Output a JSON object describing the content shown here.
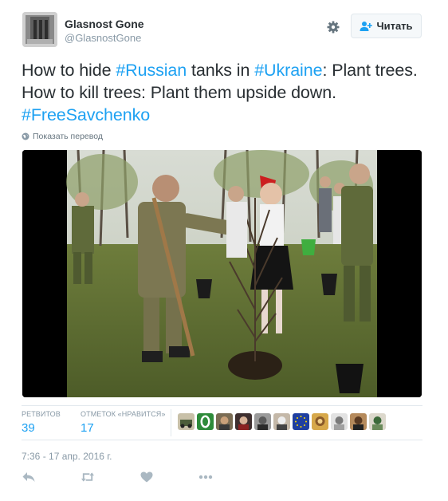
{
  "tweet": {
    "author": {
      "name": "Glasnost Gone",
      "handle": "@GlasnostGone"
    },
    "follow_button": {
      "label": "Читать",
      "icon": "add-user-icon"
    },
    "settings_icon": "gear-icon",
    "text": {
      "part1": "How to hide ",
      "hashtag1": "#Russian",
      "part2": " tanks in ",
      "hashtag2": "#Ukraine",
      "part3": ": Plant trees. How to kill trees: Plant them upside down. ",
      "hashtag3": "#FreeSavchenko"
    },
    "translate_label": "Показать перевод",
    "stats": {
      "retweets_label": "РЕТВИТОВ",
      "retweets_count": "39",
      "likes_label": "ОТМЕТОК «НРАВИТСЯ»",
      "likes_count": "17"
    },
    "timestamp": "7:36 - 17 апр. 2016 г.",
    "actions": [
      "reply-icon",
      "retweet-icon",
      "like-icon",
      "more-icon"
    ]
  },
  "colors": {
    "link": "#1da1f2",
    "text": "#292f33",
    "muted": "#8899a6",
    "border": "#e1e8ed"
  }
}
